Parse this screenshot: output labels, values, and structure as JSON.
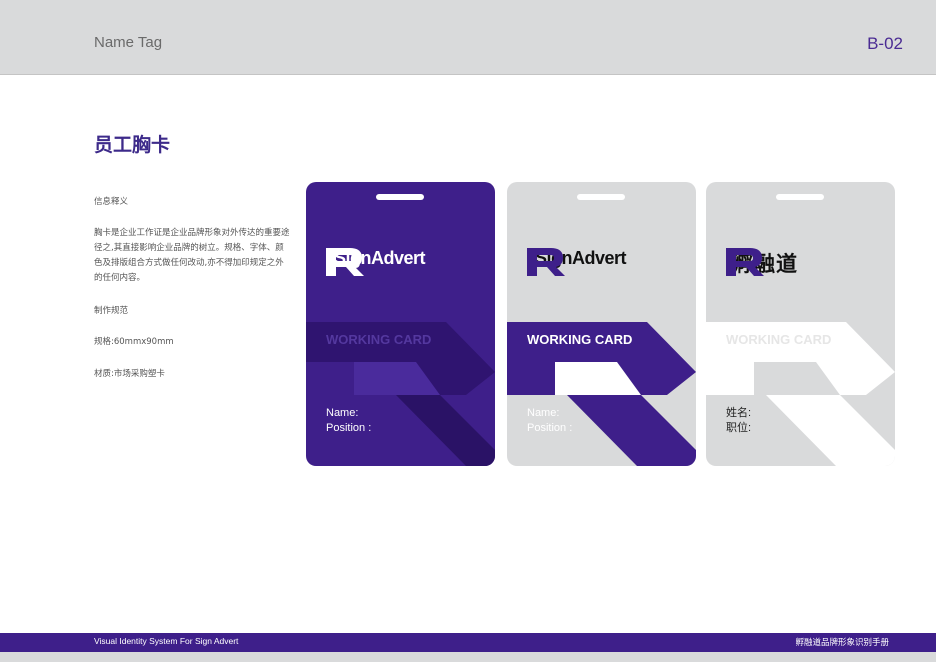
{
  "header": {
    "title": "Name Tag",
    "code": "B-02"
  },
  "section_title": "员工胸卡",
  "description": {
    "heading": "信息释义",
    "body": "胸卡是企业工作证是企业品牌形象对外传达的重要途径之,其直接影响企业品牌的树立。规格、字体、颜色及排版组合方式做任何改动,亦不得加印规定之外的任何内容。",
    "spec_heading": "制作规范",
    "size": "规格:60mmx90mm",
    "material": "材质:市场采购塑卡"
  },
  "cards": [
    {
      "brand": "SignAdvert",
      "label": "WORKING CARD",
      "field1": "Name:",
      "field2": "Position :"
    },
    {
      "brand": "SignAdvert",
      "label": "WORKING CARD",
      "field1": "Name:",
      "field2": "Position :"
    },
    {
      "brand": "孵融道",
      "label": "WORKING CARD",
      "field1": "姓名:",
      "field2": "职位:"
    }
  ],
  "colors": {
    "purple": "#3e1f8a",
    "grey": "#d9dadb",
    "white": "#ffffff"
  },
  "footer": {
    "left": "Visual Identity System For Sign Advert",
    "right": "孵融道品牌形象识别手册"
  }
}
